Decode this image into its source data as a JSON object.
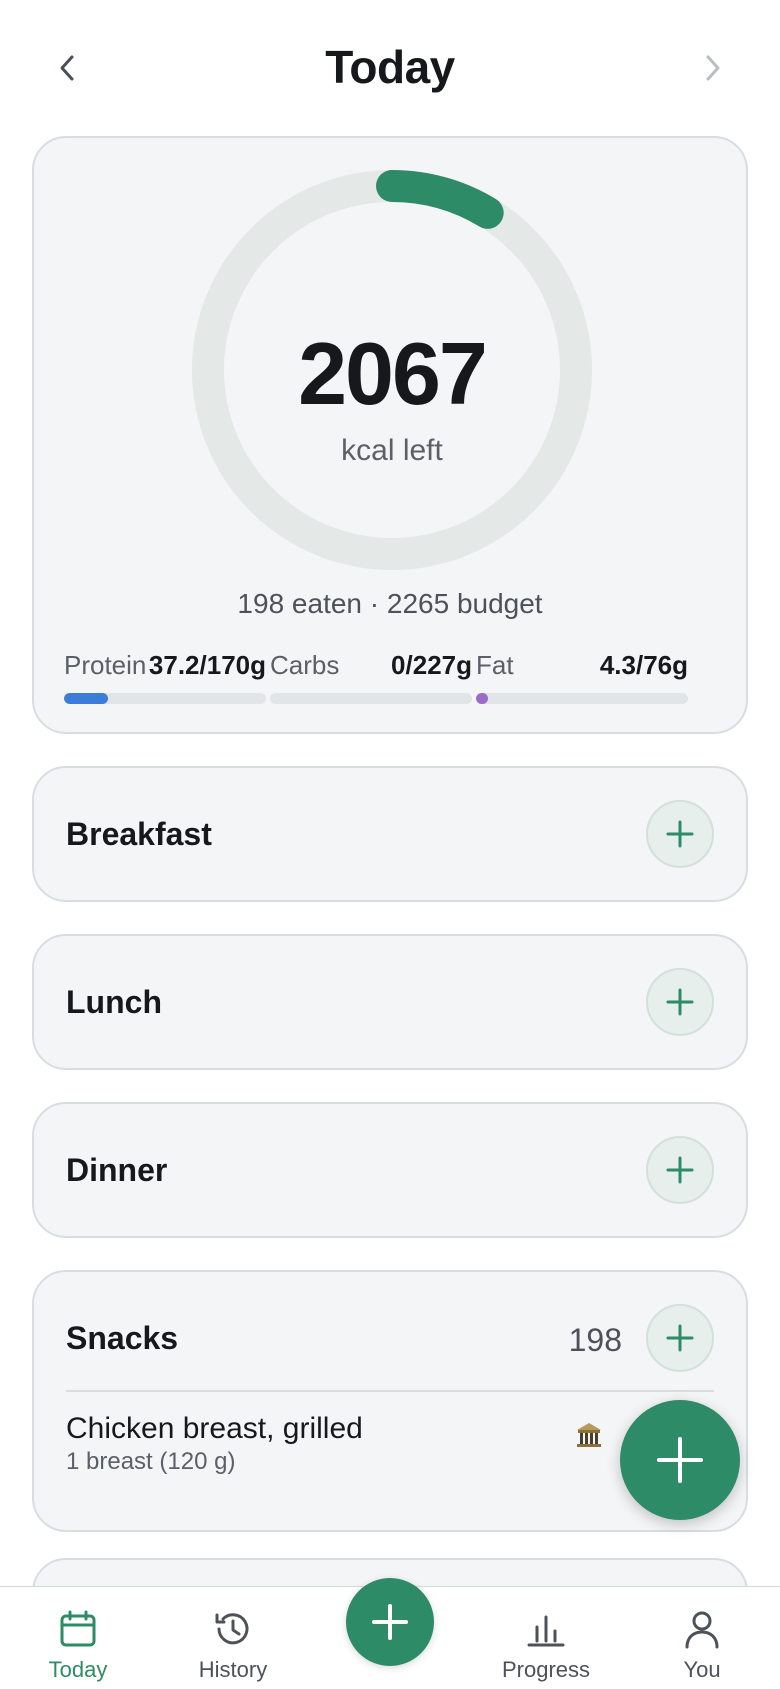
{
  "header": {
    "title": "Today",
    "prev_icon": "chevron-left-icon",
    "next_icon": "chevron-right-icon"
  },
  "summary": {
    "kcal_left": "2067",
    "kcal_left_label": "kcal left",
    "line": "198 eaten · 2265 budget",
    "progress_fraction": 0.087,
    "colors": {
      "ring_track": "#e4e8e6",
      "ring_fill": "#2e8b67"
    },
    "macros": [
      {
        "name": "Protein",
        "value": "37.2/170g",
        "fraction": 0.219,
        "color": "#3b7dd8"
      },
      {
        "name": "Carbs",
        "value": "0/227g",
        "fraction": 0,
        "color": "#e0a63a"
      },
      {
        "name": "Fat",
        "value": "4.3/76g",
        "fraction": 0.057,
        "color": "#9b6bc7"
      }
    ]
  },
  "meals": [
    {
      "title": "Breakfast"
    },
    {
      "title": "Lunch"
    },
    {
      "title": "Dinner"
    },
    {
      "title": "Snacks",
      "kcal": "198",
      "items": [
        {
          "name": "Chicken breast, grilled",
          "serving": "1 breast (120 g)",
          "source_icon": "bank-icon"
        }
      ]
    }
  ],
  "bottom_nav": {
    "tabs": [
      {
        "label": "Today",
        "icon": "calendar-icon",
        "active": true
      },
      {
        "label": "History",
        "icon": "history-icon",
        "active": false
      },
      {
        "label": "Progress",
        "icon": "bar-chart-icon",
        "active": false
      },
      {
        "label": "You",
        "icon": "person-icon",
        "active": false
      }
    ],
    "center_icon": "plus-icon"
  },
  "accent_color": "#2e8b67"
}
